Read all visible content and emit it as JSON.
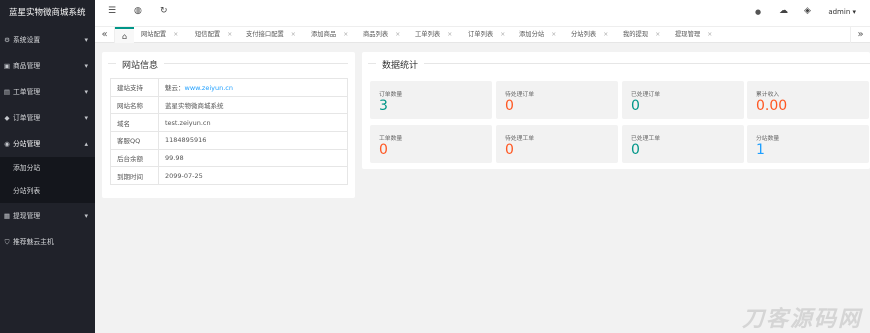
{
  "app": {
    "title": "蓝星实物微商城系统"
  },
  "sidebar": {
    "items": [
      {
        "icon": "gear-icon",
        "label": "系统设置"
      },
      {
        "icon": "box-icon",
        "label": "商品管理"
      },
      {
        "icon": "ticket-icon",
        "label": "工单管理"
      },
      {
        "icon": "cube-icon",
        "label": "订单管理"
      },
      {
        "icon": "sitemap-icon",
        "label": "分站管理",
        "sub": [
          "添加分站",
          "分站列表"
        ]
      },
      {
        "icon": "wallet-icon",
        "label": "提现管理"
      },
      {
        "icon": "shield-icon",
        "label": "推荐魅云主机"
      }
    ]
  },
  "header": {
    "menu_icon": "☰",
    "globe_icon": "◍",
    "refresh_icon": "↻",
    "bell_icon": "●",
    "theme_icon": "☁",
    "tag_icon": "◈",
    "admin": "admin ▾"
  },
  "tabs": {
    "prev": "«",
    "next": "»",
    "home_icon": "⌂",
    "items": [
      "网站配置",
      "短信配置",
      "支付接口配置",
      "添加商品",
      "商品列表",
      "工单列表",
      "订单列表",
      "添加分站",
      "分站列表",
      "我的提现",
      "提现管理"
    ],
    "close": "×"
  },
  "site_info": {
    "title": "网站信息",
    "rows": [
      {
        "key": "建站支持",
        "prefix": "魅云：",
        "link": "www.zeiyun.cn"
      },
      {
        "key": "网站名称",
        "value": "蓝星实物微商城系统"
      },
      {
        "key": "域名",
        "value": "test.zeiyun.cn"
      },
      {
        "key": "客服QQ",
        "value": "1184895916"
      },
      {
        "key": "后台余额",
        "value": "99.98"
      },
      {
        "key": "到期时间",
        "value": "2099-07-25"
      }
    ]
  },
  "stats": {
    "title": "数据统计",
    "cards": [
      {
        "label": "订单数量",
        "value": "3",
        "color": "#009688"
      },
      {
        "label": "待处理订单",
        "value": "0",
        "color": "#ff5722"
      },
      {
        "label": "已处理订单",
        "value": "0",
        "color": "#009688"
      },
      {
        "label": "累计收入",
        "value": "0.00",
        "color": "#ff5722"
      },
      {
        "label": "工单数量",
        "value": "0",
        "color": "#ff5722"
      },
      {
        "label": "待处理工单",
        "value": "0",
        "color": "#ff5722"
      },
      {
        "label": "已处理工单",
        "value": "0",
        "color": "#009688"
      },
      {
        "label": "分站数量",
        "value": "1",
        "color": "#1e9fff"
      }
    ]
  },
  "watermark": "刀客源码网"
}
